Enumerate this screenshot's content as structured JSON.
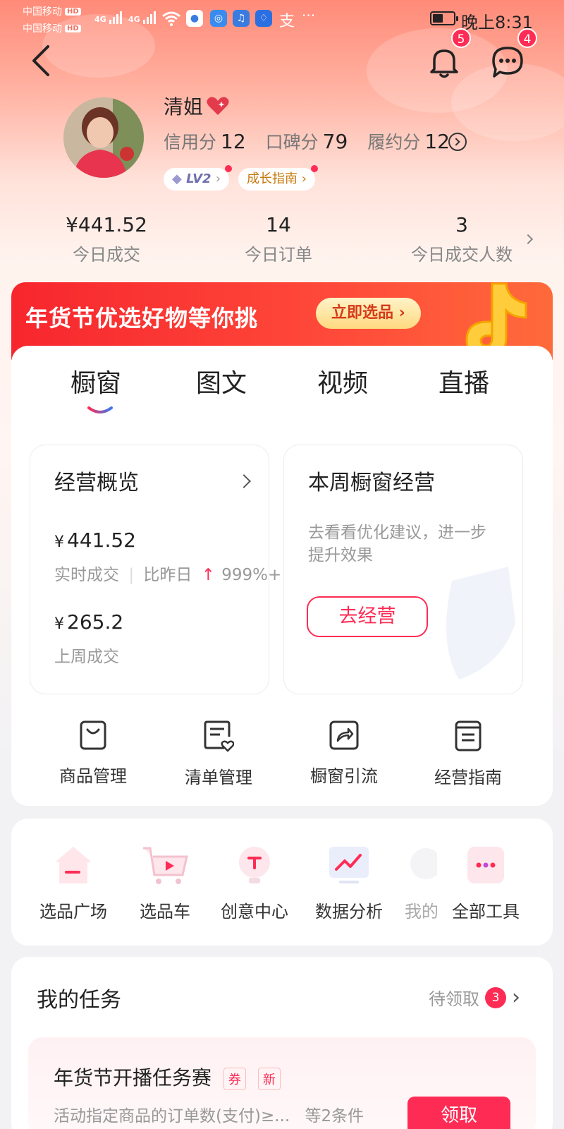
{
  "status_bar": {
    "carrier_1": "中国移动",
    "carrier_2": "中国移动",
    "hd": "HD",
    "net_1": "4G",
    "net_2": "4G",
    "alipay_glyph": "支",
    "more": "···",
    "time": "晚上8:31"
  },
  "header": {
    "notifications_count": "5",
    "messages_count": "4"
  },
  "profile": {
    "name": "清姐",
    "credit_label": "信用分",
    "credit_value": "12",
    "reputation_label": "口碑分",
    "reputation_value": "79",
    "fulfillment_label": "履约分",
    "fulfillment_value": "12",
    "level": "LV2",
    "growth_guide": "成长指南"
  },
  "today": {
    "sales_value": "¥441.52",
    "sales_label": "今日成交",
    "orders_value": "14",
    "orders_label": "今日订单",
    "buyers_value": "3",
    "buyers_label": "今日成交人数"
  },
  "banner": {
    "text": "年货节优选好物等你挑",
    "button": "立即选品"
  },
  "tabs": [
    "橱窗",
    "图文",
    "视频",
    "直播"
  ],
  "overview": {
    "title": "经营概览",
    "realtime_yen": "¥",
    "realtime_value": "441.52",
    "realtime_label": "实时成交",
    "compare_label": "比昨日",
    "compare_value": "999%+",
    "lastweek_yen": "¥",
    "lastweek_value": "265.2",
    "lastweek_label": "上周成交"
  },
  "weekly": {
    "title": "本周橱窗经营",
    "desc_line1": "去看看优化建议，进一步",
    "desc_line2": "提升效果",
    "button": "去经营"
  },
  "quick_tools": [
    "商品管理",
    "清单管理",
    "橱窗引流",
    "经营指南"
  ],
  "tools": [
    "选品广场",
    "选品车",
    "创意中心",
    "数据分析",
    "我的",
    "全部工具"
  ],
  "tasks": {
    "title": "我的任务",
    "pending_label": "待领取",
    "pending_count": "3",
    "task_name": "年货节开播任务赛",
    "tag_coupon": "券",
    "tag_new": "新",
    "task_desc": "活动指定商品的订单数(支付)≥...",
    "task_cond": "等2条件",
    "claim": "领取"
  },
  "colors": {
    "accent": "#fe2c55",
    "banner_red": "#f7262e",
    "header_gradient_top": "#ff8a78"
  }
}
